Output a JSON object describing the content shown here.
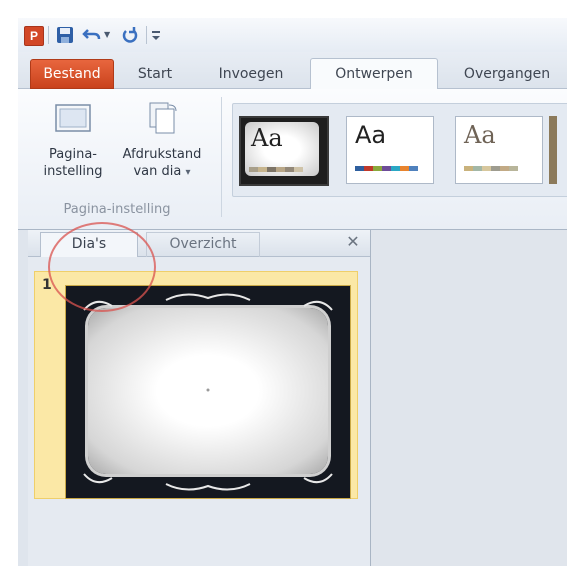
{
  "qat": {
    "app_icon_letter": "P"
  },
  "tabs": {
    "file": "Bestand",
    "start": "Start",
    "insert": "Invoegen",
    "design": "Ontwerpen",
    "transitions": "Overgangen"
  },
  "ribbon": {
    "page_setup_line1": "Pagina-",
    "page_setup_line2": "instelling",
    "orientation_line1": "Afdrukstand",
    "orientation_line2": "van dia",
    "orientation_arrow": "▾",
    "group_label": "Pagina-instelling",
    "theme_label": "Aa"
  },
  "pane": {
    "tab_slides": "Dia's",
    "tab_outline": "Overzicht",
    "close_glyph": "✕",
    "slide_number": "1"
  },
  "colors": {
    "file_tab": "#d24726",
    "annotation": "#d9534f",
    "selection": "#fbe8a6"
  },
  "icons": {
    "app": "powerpoint-icon",
    "save": "save-icon",
    "undo": "undo-icon",
    "redo": "redo-icon",
    "customize": "customize-qat-icon"
  }
}
